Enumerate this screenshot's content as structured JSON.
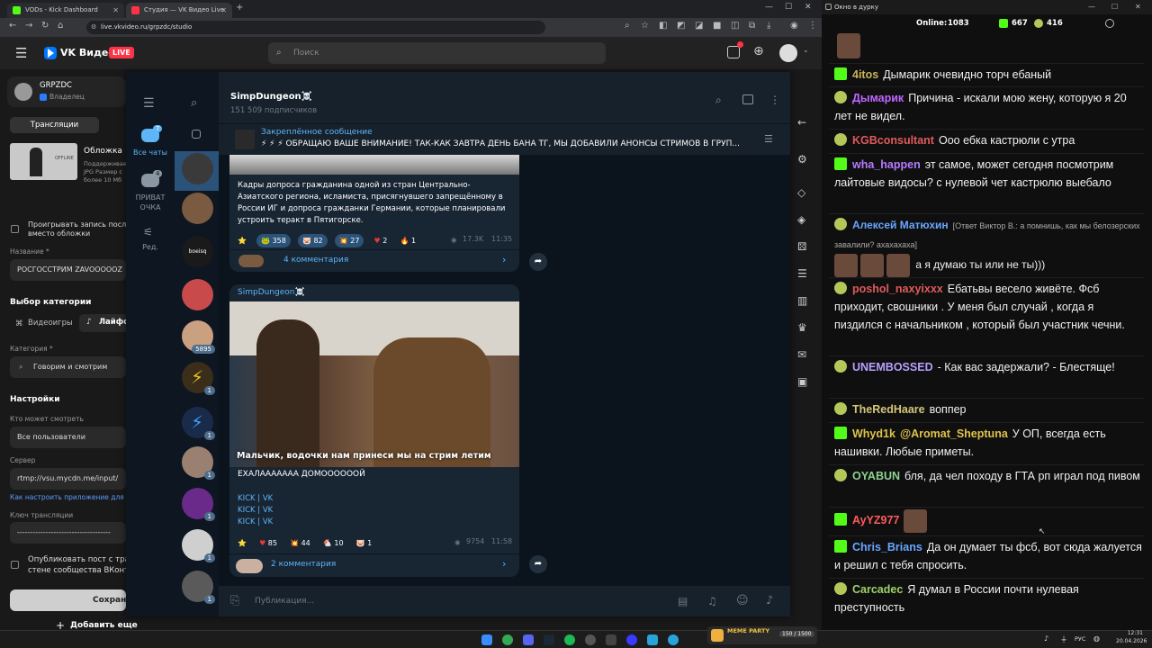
{
  "browser": {
    "tabs": [
      {
        "title": "VODs - Kick Dashboard",
        "favicon_color": "#53fc18"
      },
      {
        "title": "Студия — VK Видео Live",
        "favicon_color": "#ff3347"
      }
    ],
    "url": "live.vkvideo.ru/grpzdc/studio"
  },
  "vk": {
    "logo_text": "VK Видео",
    "live_badge": "LIVE",
    "search_placeholder": "Поиск",
    "channel_name": "GRPZDC",
    "channel_role": "Владелец",
    "nav_broadcasts": "Трансляции",
    "cover_title": "Обложка",
    "cover_desc_1": "Поддерживае",
    "cover_desc_2": "JPG Размер с",
    "cover_desc_3": "более 10 Мб",
    "cover_thumb_label": "OFFLINE",
    "record_label_1": "Проигрывать запись после",
    "record_label_2": "вместо обложки",
    "name_label": "Название *",
    "name_value": "РОСГОССТРИМ ZAVOOOOOZ",
    "category_section": "Выбор категории",
    "cat_games": "Видеоигры",
    "cat_life": "Лайфст",
    "category_label": "Категория *",
    "category_value": "Говорим и смотрим",
    "settings_section": "Настройки",
    "who_label": "Кто может смотреть",
    "who_value": "Все пользователи",
    "server_label": "Сервер",
    "server_value": "rtmp://vsu.mycdn.me/input/",
    "how_to_link": "Как настроить приложение для т",
    "key_label": "Ключ трансляции",
    "key_value": "------------------------------------",
    "publish_label_1": "Опубликовать пост с тра",
    "publish_label_2": "стене сообщества ВКонт",
    "save_button": "Сохрани",
    "add_more_button": "Добавить еще"
  },
  "tg": {
    "channel_title": "SimpDungeon☠️",
    "subscribers": "151 509 подписчиков",
    "pinned_label": "Закреплённое сообщение",
    "pinned_text": "⚡ ⚡ ⚡ ОБРАЩАЮ ВАШЕ ВНИМАНИЕ!  ТАК-КАК ЗАВТРА ДЕНЬ БАНА ТГ, МЫ ДОБАВИЛИ АНОНСЫ СТРИМОВ В ГРУП...",
    "rail": [
      {
        "label": "Все чаты",
        "badge": "7"
      },
      {
        "label": "ПРИВАТ ОЧКА",
        "badge": "4"
      },
      {
        "label": "Ред.",
        "badge": ""
      }
    ],
    "chat_badges": [
      "",
      "",
      "",
      "",
      "5895",
      "1",
      "1",
      "1",
      "1",
      "1",
      "1"
    ],
    "post1": {
      "text": "Кадры допроса гражданина одной из стран Центрально-Азиатского региона, исламиста, присягнувшего запрещённому в России ИГ и допроса гражданки Германии, которые планировали устроить теракт в Пятигорске.",
      "reactions": [
        {
          "emoji": "⭐",
          "count": ""
        },
        {
          "emoji": "🐸",
          "count": "358"
        },
        {
          "emoji": "🐷",
          "count": "82"
        },
        {
          "emoji": "💥",
          "count": "27"
        },
        {
          "emoji": "♥",
          "count": "2"
        },
        {
          "emoji": "🔥",
          "count": "1"
        }
      ],
      "views": "17.3K",
      "time": "11:35",
      "comments": "4 комментария"
    },
    "post2": {
      "author": "SimpDungeon☠️",
      "caption": "Мальчик, водочки нам принеси  мы на стрим летим",
      "text": "ЕХАЛААААААА ДОМООООООЙ",
      "links": [
        "KICK | VK",
        "KICK | VK",
        "KICK | VK"
      ],
      "reactions": [
        {
          "emoji": "⭐",
          "count": ""
        },
        {
          "emoji": "♥",
          "count": "85"
        },
        {
          "emoji": "💥",
          "count": "44"
        },
        {
          "emoji": "🐔",
          "count": "10"
        },
        {
          "emoji": "🐷",
          "count": "1"
        }
      ],
      "views": "9754",
      "time": "11:58",
      "comments": "2 комментария"
    },
    "input_placeholder": "Публикация..."
  },
  "chat": {
    "window_title": "Окно в дурку",
    "online_label": "Online:",
    "online_count": "1083",
    "kick_count": "667",
    "vk_count": "416",
    "messages": [
      {
        "badge": "k",
        "user": "4itos",
        "color": "#c9b458",
        "text": "Дымарик очевидно торч ебаный"
      },
      {
        "badge": "o",
        "user": "Дымарик",
        "color": "#c267ff",
        "text": "Причина - искали мою жену, которую я 20 лет не видел."
      },
      {
        "badge": "o",
        "user": "KGBconsultant",
        "color": "#e05a5a",
        "text": "Ооо ебка кастрюли с утра"
      },
      {
        "badge": "k",
        "user": "wha_happen",
        "color": "#b57cff",
        "text": "эт самое, может сегодня посмотрим лайтовые видосы? с нулевой чет кастрюлю выебало"
      },
      {
        "badge": "o",
        "user": "Алексей Матюхин",
        "color": "#6aa6ff",
        "reply": "[Ответ Виктор В.: а помнишь, как мы белозерских завалили? ахахахаха]",
        "text": "а я думаю ты или не ты)))"
      },
      {
        "badge": "o",
        "user": "poshol_naxyixxx",
        "color": "#e05a5a",
        "text": "Ебатьвы весело живёте. Фсб приходит, свошники . У меня был случай , когда я пиздился с начальником , который был участник чечни."
      },
      {
        "badge": "o",
        "user": "UNEMBOSSED",
        "color": "#b8a0ff",
        "text": "- Как вас задержали? - Блестяще!"
      },
      {
        "badge": "o",
        "user": "TheRedHaare",
        "color": "#d4c67a",
        "text": "воппер"
      },
      {
        "badge": "k",
        "user": "Whyd1k",
        "color": "#e0c24a",
        "mention": "@Aromat_Sheptuna",
        "text": "У ОП, всегда есть нашивки. Любые приметы."
      },
      {
        "badge": "o",
        "user": "OYABUN",
        "color": "#8fd18f",
        "text": "бля, да чел походу в ГТА рп играл под пивом"
      },
      {
        "badge": "k",
        "user": "AyYZ977",
        "color": "#ff5a5a",
        "text": ""
      },
      {
        "badge": "k",
        "user": "Chris_Brians",
        "color": "#6aa6ff",
        "text": "Да он думает ты фсб, вот сюда жалуется и решил с тебя спросить."
      },
      {
        "badge": "o",
        "user": "Carcadec",
        "color": "#9ed26a",
        "text": "Я думал в России почти нулевая преступность"
      }
    ]
  },
  "taskbar": {
    "lang": "РУС",
    "time": "12:31",
    "date": "20.04.2026",
    "media_label": "MEME PARTY",
    "media_counter": "150 / 1500"
  }
}
